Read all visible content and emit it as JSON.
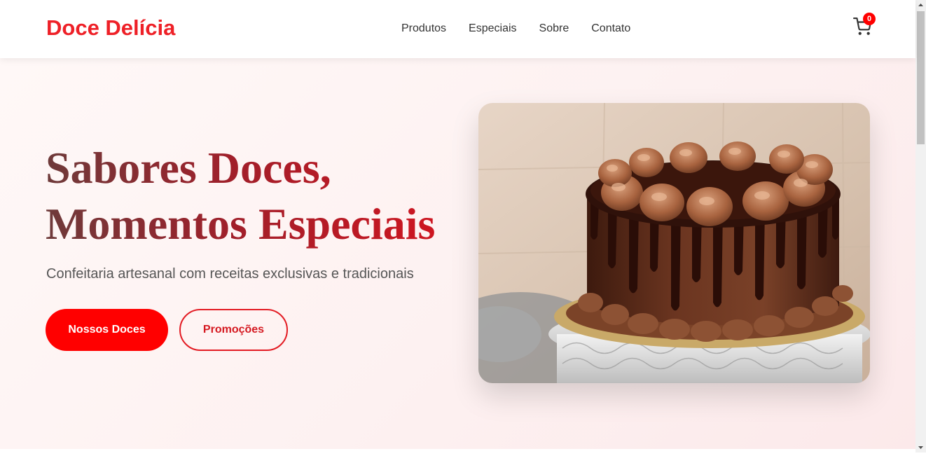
{
  "header": {
    "logo": "Doce Delícia",
    "nav": [
      "Produtos",
      "Especiais",
      "Sobre",
      "Contato"
    ],
    "cart_icon": "cart-icon",
    "cart_count": "0"
  },
  "hero": {
    "title_line1": "Sabores Doces,",
    "title_line2": "Momentos Especiais",
    "subtitle": "Confeitaria artesanal com receitas exclusivas e tradicionais",
    "primary_button": "Nossos Doces",
    "secondary_button": "Promoções"
  },
  "colors": {
    "brand": "#ee2027",
    "primary_button": "#ff0000",
    "cart_badge": "#ff0000",
    "title_gradient_start": "#6e3a3a",
    "title_gradient_end": "#d4141f"
  }
}
